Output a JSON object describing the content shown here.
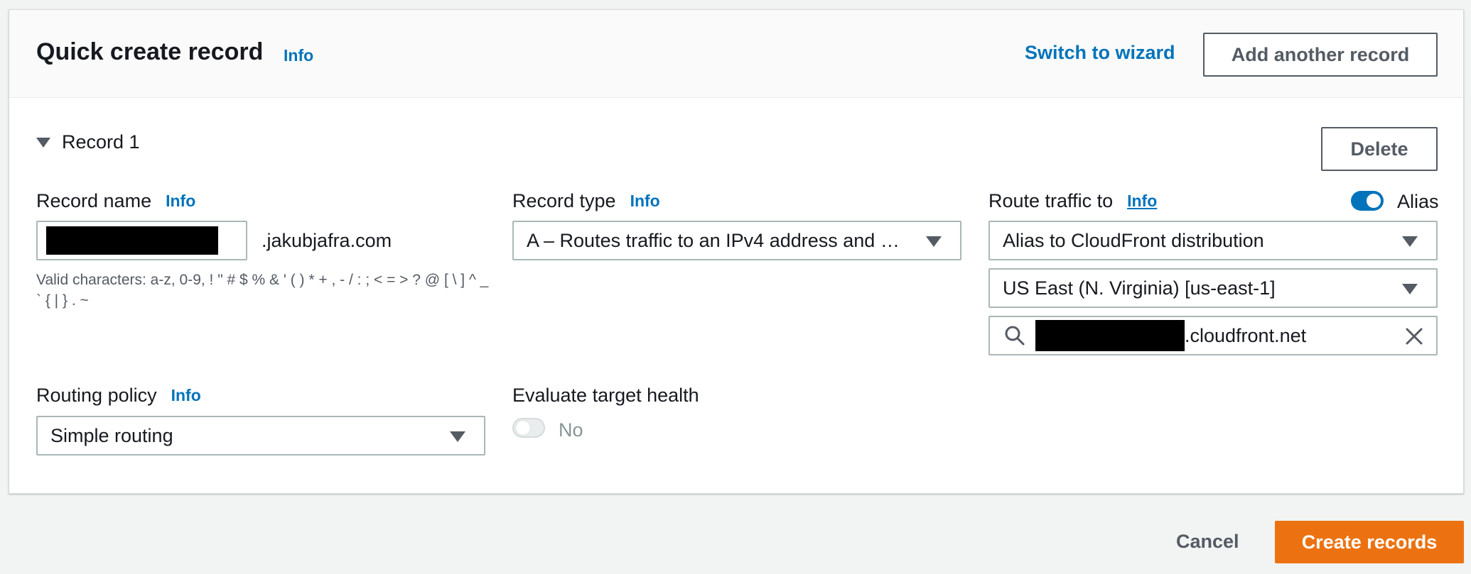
{
  "header": {
    "title": "Quick create record",
    "info": "Info",
    "switch_link": "Switch to wizard",
    "add_button": "Add another record"
  },
  "record": {
    "toggle_label": "Record 1",
    "delete_button": "Delete",
    "name": {
      "label": "Record name",
      "info": "Info",
      "value": "",
      "suffix": ".jakubjafra.com",
      "hint": "Valid characters: a-z, 0-9, ! \" # $ % & ' ( ) * + , - / : ; < = > ? @ [ \\ ] ^ _ ` { | } . ~"
    },
    "type": {
      "label": "Record type",
      "info": "Info",
      "value": "A – Routes traffic to an IPv4 address and some AWS resources"
    },
    "route": {
      "label": "Route traffic to",
      "info": "Info",
      "alias_label": "Alias",
      "alias_on": true,
      "endpoint": "Alias to CloudFront distribution",
      "region": "US East (N. Virginia) [us-east-1]",
      "target_suffix": ".cloudfront.net"
    },
    "routing_policy": {
      "label": "Routing policy",
      "info": "Info",
      "value": "Simple routing"
    },
    "health": {
      "label": "Evaluate target health",
      "toggle_text": "No",
      "enabled": false
    }
  },
  "footer": {
    "cancel": "Cancel",
    "create": "Create records"
  },
  "colors": {
    "link": "#0073bb",
    "primary": "#ec7211",
    "toggle_on": "#0073bb"
  }
}
